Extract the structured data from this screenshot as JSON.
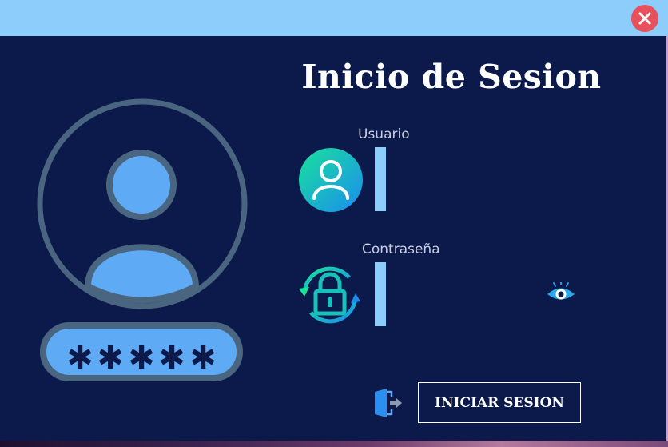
{
  "window": {
    "close_icon": "close-icon",
    "colors": {
      "titlebar": "#8ccdfb",
      "background": "#0c1a4b",
      "close": "#e8505b"
    }
  },
  "login": {
    "title": "Inicio de Sesion",
    "username_label": "Usuario",
    "username_value": "",
    "password_label": "Contraseña",
    "password_value": "",
    "submit_label": "INICIAR SESION"
  },
  "illustration": {
    "password_mask": "*****"
  },
  "icons": {
    "user": "user-icon",
    "lock": "lock-icon",
    "eye": "eye-icon",
    "exit": "exit-door-icon",
    "avatar": "avatar-illustration"
  }
}
